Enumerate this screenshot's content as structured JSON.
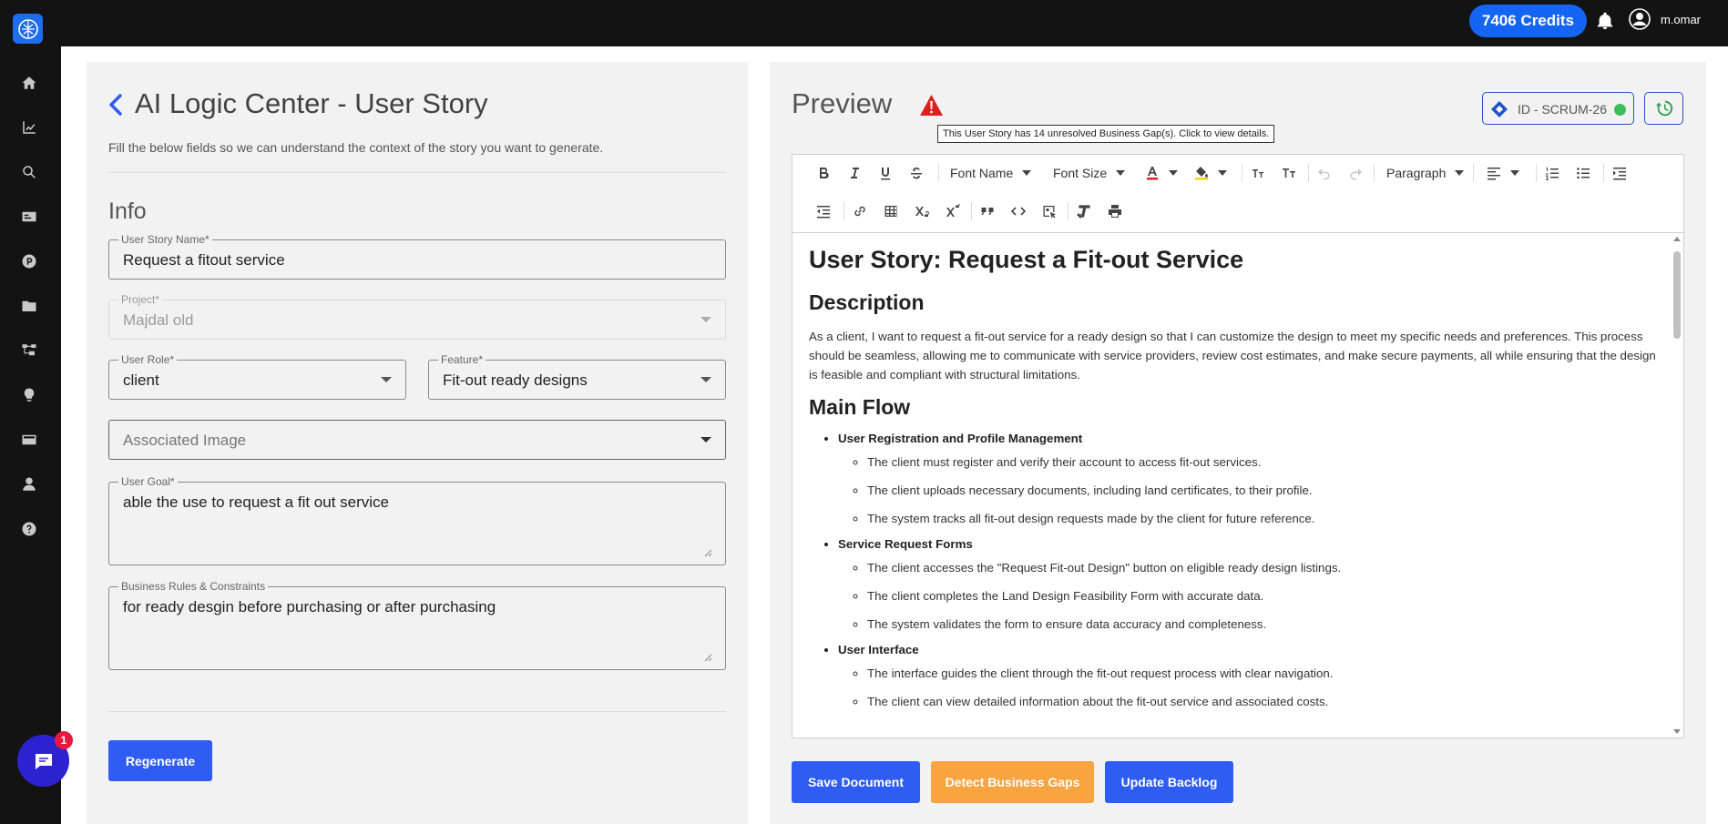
{
  "topbar": {
    "credits": "7406 Credits",
    "username": "m.omar"
  },
  "sidebar": {
    "items": [
      "home-icon",
      "chart-icon",
      "search-icon",
      "id-card-icon",
      "p-badge-icon",
      "folder-icon",
      "hierarchy-icon",
      "lightbulb-icon",
      "card-icon",
      "user-icon",
      "help-icon"
    ]
  },
  "form": {
    "title": "AI Logic Center - User Story",
    "subtitle": "Fill the below fields so we can understand the context of the story you want to generate.",
    "section": "Info",
    "story_name": {
      "label": "User Story Name*",
      "value": "Request a fitout service"
    },
    "project": {
      "label": "Project*",
      "value": "Majdal old"
    },
    "user_role": {
      "label": "User Role*",
      "value": "client"
    },
    "feature": {
      "label": "Feature*",
      "value": "Fit-out ready designs"
    },
    "image": {
      "placeholder": "Associated Image"
    },
    "user_goal": {
      "label": "User Goal*",
      "value": "able the use to request a fit out service"
    },
    "rules": {
      "label": "Business Rules & Constraints",
      "value": "for ready desgin before purchasing or after purchasing"
    },
    "regenerate": "Regenerate"
  },
  "chat": {
    "badge": "1"
  },
  "preview": {
    "title": "Preview",
    "tooltip": "This User Story has 14 unresolved Business Gap(s). Click to view details.",
    "scrum_id": "ID - SCRUM-26",
    "toolbar": {
      "font_name": "Font Name",
      "font_size": "Font Size",
      "paragraph": "Paragraph"
    },
    "doc": {
      "h1": "User Story: Request a Fit-out Service",
      "desc_heading": "Description",
      "desc": "As a client, I want to request a fit-out service for a ready design so that I can customize the design to meet my specific needs and preferences. This process should be seamless, allowing me to communicate with service providers, review cost estimates, and make secure payments, all while ensuring that the design is feasible and compliant with structural limitations.",
      "flow_heading": "Main Flow",
      "sections": [
        {
          "title": "User Registration and Profile Management",
          "items": [
            "The client must register and verify their account to access fit-out services.",
            "The client uploads necessary documents, including land certificates, to their profile.",
            "The system tracks all fit-out design requests made by the client for future reference."
          ]
        },
        {
          "title": "Service Request Forms",
          "items": [
            "The client accesses the \"Request Fit-out Design\" button on eligible ready design listings.",
            "The client completes the Land Design Feasibility Form with accurate data.",
            "The system validates the form to ensure data accuracy and completeness."
          ]
        },
        {
          "title": "User Interface",
          "items": [
            "The interface guides the client through the fit-out request process with clear navigation.",
            "The client can view detailed information about the fit-out service and associated costs."
          ]
        }
      ]
    },
    "buttons": {
      "save": "Save Document",
      "detect": "Detect Business Gaps",
      "update": "Update Backlog"
    }
  }
}
